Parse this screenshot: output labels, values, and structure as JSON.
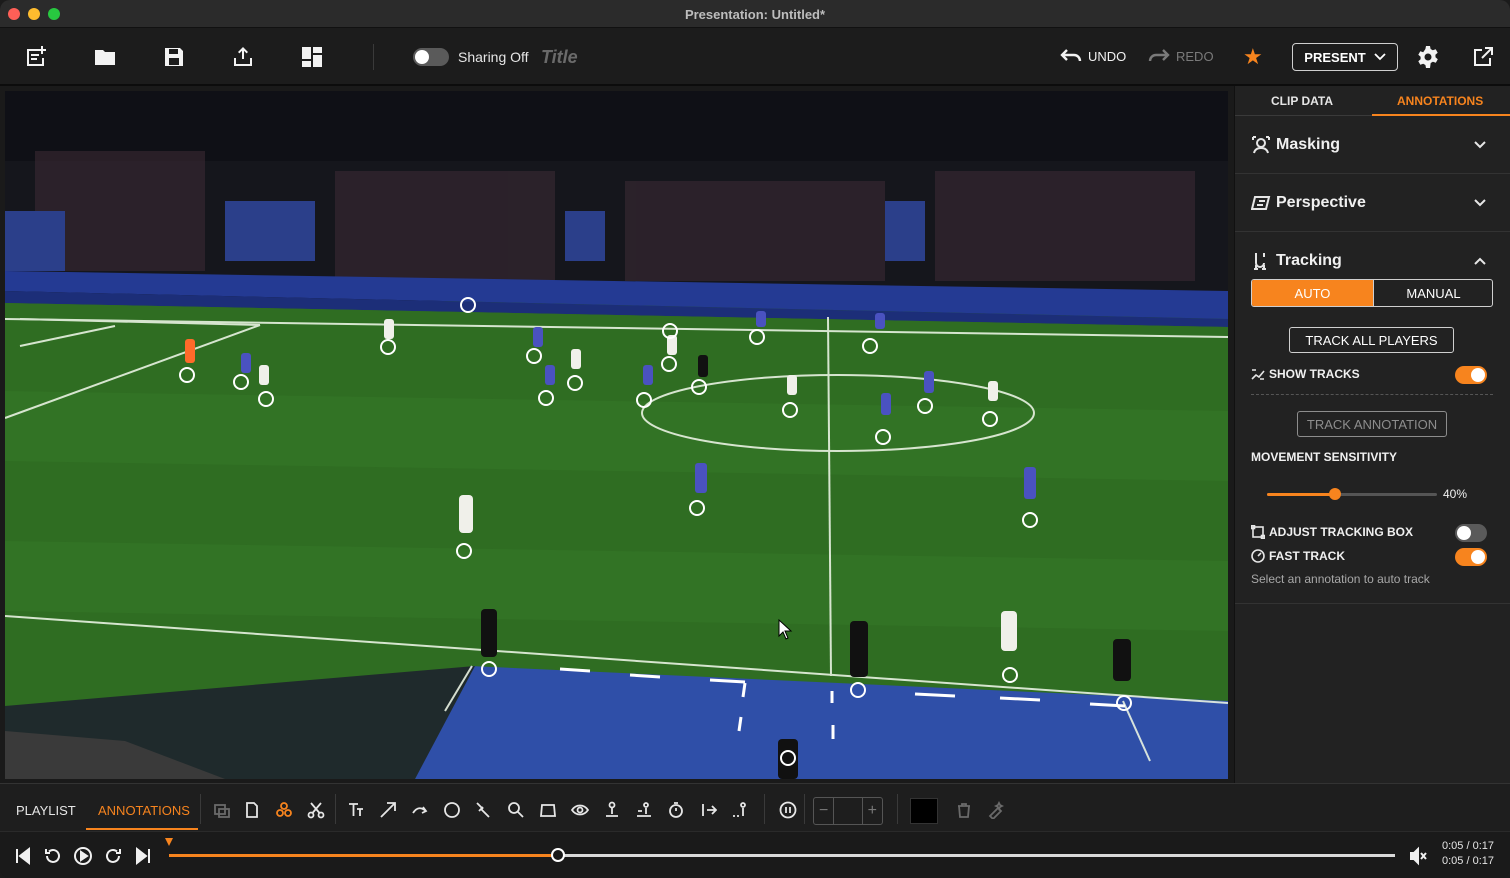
{
  "window": {
    "title": "Presentation: Untitled*"
  },
  "toolbar": {
    "sharing_label": "Sharing Off",
    "title_placeholder": "Title",
    "undo_label": "UNDO",
    "redo_label": "REDO",
    "present_label": "PRESENT"
  },
  "panel": {
    "tabs": [
      "CLIP DATA",
      "ANNOTATIONS"
    ],
    "active_tab": "ANNOTATIONS",
    "sections": {
      "masking": "Masking",
      "perspective": "Perspective",
      "tracking": "Tracking"
    },
    "mode": {
      "auto": "AUTO",
      "manual": "MANUAL",
      "selected": "AUTO"
    },
    "track_all_label": "TRACK ALL PLAYERS",
    "show_tracks_label": "SHOW TRACKS",
    "show_tracks_on": true,
    "track_annotation_label": "TRACK ANNOTATION",
    "sensitivity_label": "MOVEMENT SENSITIVITY",
    "sensitivity_value": 40,
    "sensitivity_text": "40%",
    "adjust_box_label": "ADJUST TRACKING BOX",
    "adjust_box_on": false,
    "fast_track_label": "FAST TRACK",
    "fast_track_on": true,
    "hint": "Select an annotation to auto track"
  },
  "bottom": {
    "tabs": [
      "PLAYLIST",
      "ANNOTATIONS"
    ],
    "active_tab": "ANNOTATIONS"
  },
  "playback": {
    "progress": 0.3172,
    "time_current": "0:05 / 0:17",
    "time_total": "0:05 / 0:17"
  },
  "colors": {
    "accent": "#f7841e",
    "background": "#1a1a1a",
    "pitch": "#2f6d22"
  }
}
